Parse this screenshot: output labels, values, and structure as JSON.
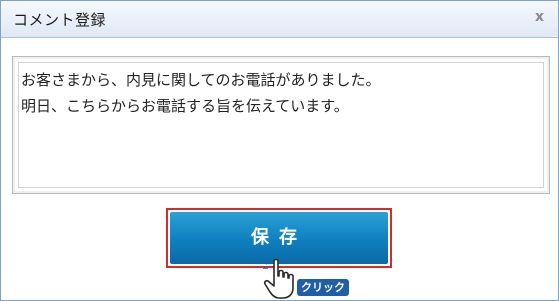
{
  "dialog": {
    "title": "コメント登録",
    "close_label": "x"
  },
  "comment": {
    "lines": [
      "お客さまから、内見に関してのお電話がありました。",
      "明日、こちらからお電話する旨を伝えています。"
    ]
  },
  "actions": {
    "save_label": "保存"
  },
  "annotation": {
    "click_label": "クリック"
  },
  "colors": {
    "button_blue": "#0f7fbe",
    "highlight_red": "#d42b2b",
    "badge_blue": "#1f5fa8"
  }
}
